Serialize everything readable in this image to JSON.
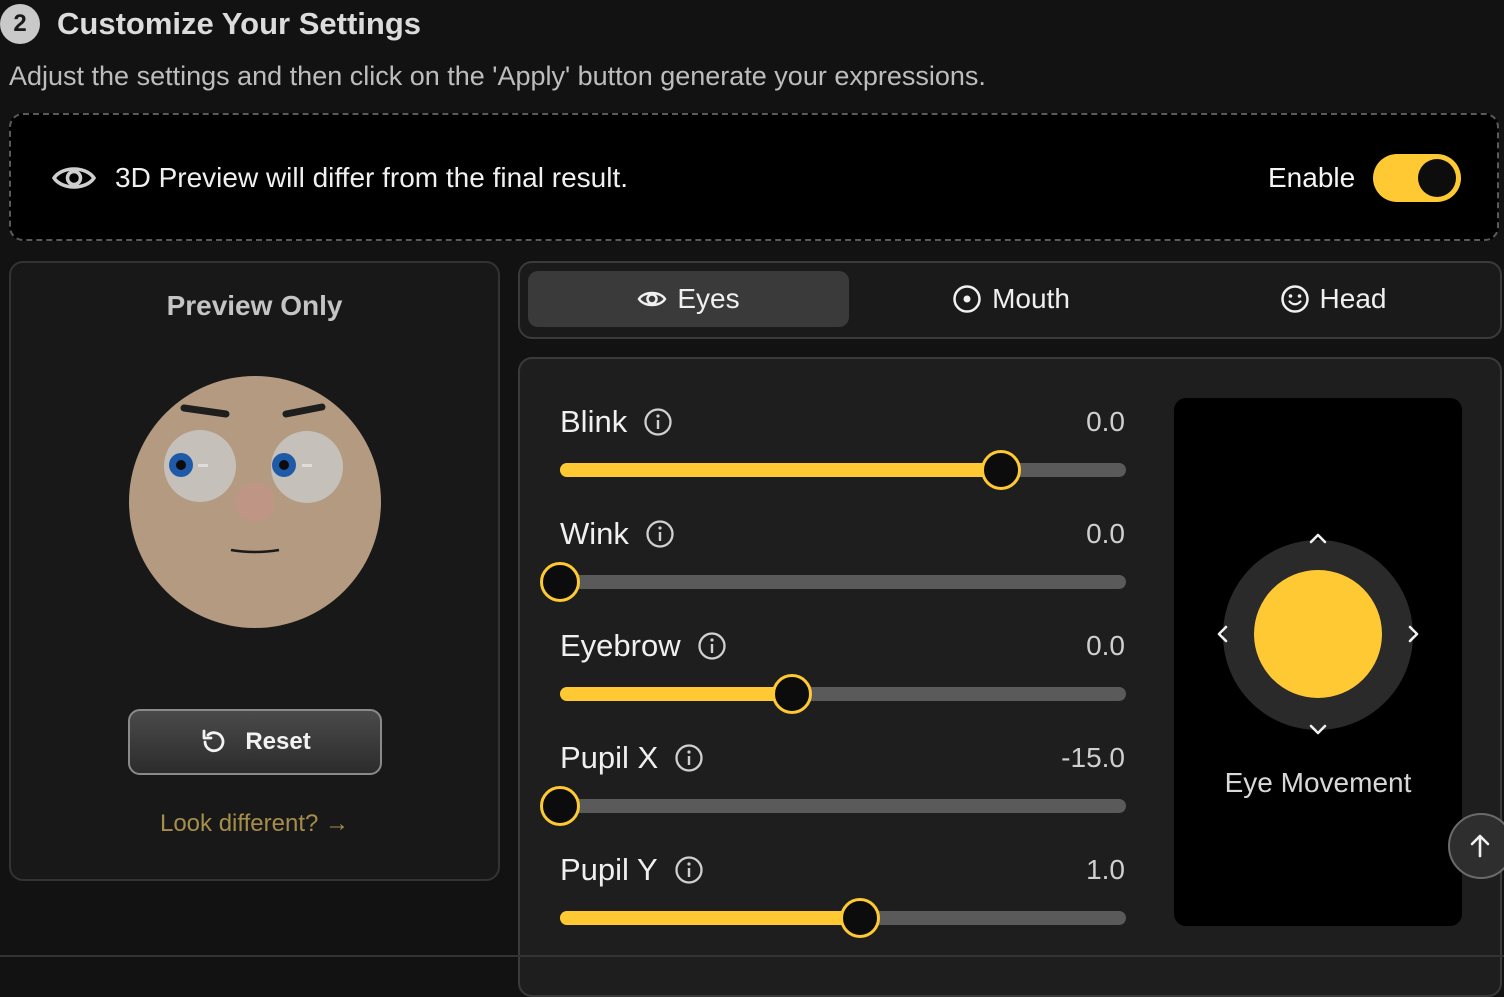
{
  "header": {
    "step_number": "2",
    "title": "Customize Your Settings",
    "subtitle": "Adjust the settings and then click on the 'Apply' button generate your expressions."
  },
  "notice": {
    "icon": "eye-icon",
    "text": "3D Preview will differ from the final result.",
    "enable_label": "Enable",
    "enable_on": true
  },
  "preview": {
    "title": "Preview Only",
    "reset_label": "Reset",
    "look_different": "Look different? →"
  },
  "tabs": [
    {
      "label": "Eyes",
      "icon": "eye-icon",
      "active": true
    },
    {
      "label": "Mouth",
      "icon": "target-icon",
      "active": false
    },
    {
      "label": "Head",
      "icon": "smiley-icon",
      "active": false
    }
  ],
  "sliders": [
    {
      "label": "Blink",
      "value": "0.0",
      "fill": 0.78
    },
    {
      "label": "Wink",
      "value": "0.0",
      "fill": 0.0
    },
    {
      "label": "Eyebrow",
      "value": "0.0",
      "fill": 0.41
    },
    {
      "label": "Pupil X",
      "value": "-15.0",
      "fill": 0.0
    },
    {
      "label": "Pupil Y",
      "value": "1.0",
      "fill": 0.53
    }
  ],
  "eye_movement": {
    "label": "Eye Movement"
  },
  "colors": {
    "accent": "#ffc933",
    "background": "#121212",
    "panel": "#1e1e1e"
  }
}
